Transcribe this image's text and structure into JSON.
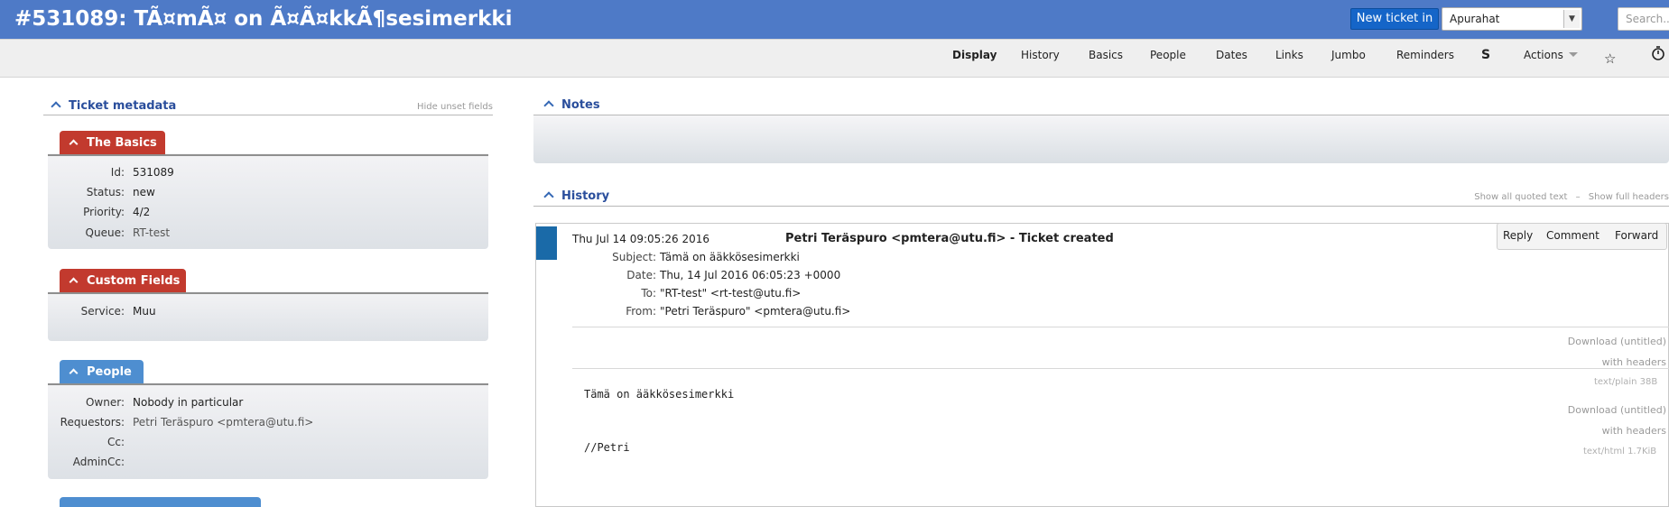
{
  "header": {
    "title": "#531089: TÃ¤mÃ¤ on Ã¤Ã¤kkÃ¶sesimerkki",
    "new_ticket_label": "New ticket in",
    "queue_selected": "Apurahat",
    "search_placeholder": "Search..."
  },
  "menu": {
    "items": [
      "Display",
      "History",
      "Basics",
      "People",
      "Dates",
      "Links",
      "Jumbo",
      "Reminders",
      "S",
      "Actions"
    ],
    "active": "Display"
  },
  "metadata": {
    "title": "Ticket metadata",
    "hide_unset": "Hide unset fields",
    "basics": {
      "title": "The Basics",
      "fields": [
        {
          "label": "Id:",
          "value": "531089"
        },
        {
          "label": "Status:",
          "value": "new"
        },
        {
          "label": "Priority:",
          "value": "4/2"
        },
        {
          "label": "Queue:",
          "value": "RT-test"
        }
      ]
    },
    "custom_fields": {
      "title": "Custom Fields",
      "fields": [
        {
          "label": "Service:",
          "value": "Muu"
        }
      ]
    },
    "people": {
      "title": "People",
      "fields": [
        {
          "label": "Owner:",
          "value": "Nobody in particular"
        },
        {
          "label": "Requestors:",
          "value": "Petri Teräspuro <pmtera@utu.fi>"
        },
        {
          "label": "Cc:",
          "value": ""
        },
        {
          "label": "AdminCc:",
          "value": ""
        }
      ]
    }
  },
  "notes": {
    "title": "Notes"
  },
  "history": {
    "title": "History",
    "show_quoted": "Show all quoted text",
    "separator": "–",
    "show_headers": "Show full headers",
    "transaction": {
      "date": "Thu Jul 14 09:05:26 2016",
      "description": "Petri Teräspuro <pmtera@utu.fi> - Ticket created",
      "actions": [
        "Reply",
        "Comment",
        "Forward"
      ],
      "headers": [
        {
          "label": "Subject:",
          "value": "Tämä on ääkkösesimerkki"
        },
        {
          "label": "Date:",
          "value": "Thu, 14 Jul 2016 06:05:23 +0000"
        },
        {
          "label": "To:",
          "value": "\"RT-test\" <rt-test@utu.fi>"
        },
        {
          "label": "From:",
          "value": "\"Petri Teräspuro\" <pmtera@utu.fi>"
        }
      ],
      "attachments": [
        {
          "download": "Download (untitled)",
          "with_headers": "with headers",
          "type": "text/plain 38B"
        },
        {
          "download": "Download (untitled)",
          "with_headers": "with headers",
          "type": "text/html 1.7KiB"
        }
      ],
      "body": [
        "Tämä on ääkkösesimerkki",
        "//Petri"
      ]
    }
  },
  "colors": {
    "header_bg": "#4e7ac7",
    "new_ticket_bg": "#1565c8",
    "tab_red": "#c23a2e",
    "tab_blue": "#4e8ed0",
    "title_link": "#2a4e9c",
    "txn_bar": "#1a6aa8"
  }
}
